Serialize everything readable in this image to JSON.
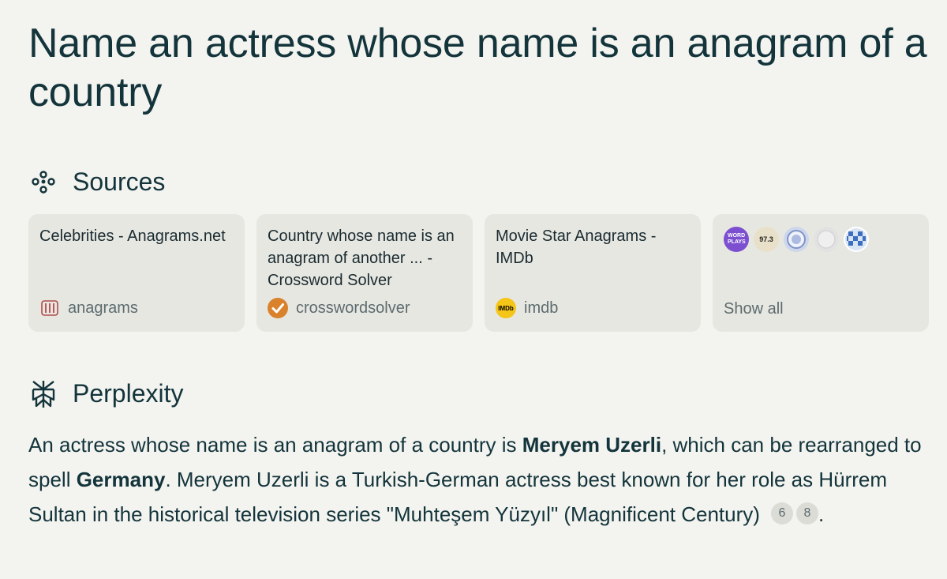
{
  "query": {
    "title": "Name an actress whose name is an anagram of a country"
  },
  "sources": {
    "heading": "Sources",
    "cards": [
      {
        "title": "Celebrities - Anagrams.net",
        "domain": "anagrams",
        "icon": "anagrams-favicon"
      },
      {
        "title": "Country whose name is an anagram of another ... - Crossword Solver",
        "domain": "crosswordsolver",
        "icon": "checkmark-favicon"
      },
      {
        "title": "Movie Star Anagrams - IMDb",
        "domain": "imdb",
        "icon": "imdb-favicon"
      }
    ],
    "more": {
      "label": "Show all",
      "favicons": [
        "wordplays-favicon",
        "radio-97-3-favicon",
        "globe-favicon",
        "blank-favicon",
        "checker-favicon"
      ],
      "wordplays_text": "WORD PLAYS",
      "radio_text": "97.3"
    },
    "imdb_badge": "IMDb"
  },
  "answer": {
    "heading": "Perplexity",
    "part1": "An actress whose name is an anagram of a country is ",
    "bold1": "Meryem Uzerli",
    "part2": ", which can be rearranged to spell ",
    "bold2": "Germany",
    "part3": ". Meryem Uzerli is a Turkish-German actress best known for her role as Hürrem Sultan in the historical television series \"Muhteşem Yüzyıl\" (Magnificent Century)",
    "citations": [
      "6",
      "8"
    ],
    "end": "."
  },
  "colors": {
    "background": "#f3f3ef",
    "card": "#e7e7e2",
    "text": "#13343b",
    "muted": "#5d6b6e",
    "checkmark_orange": "#d9822b",
    "imdb_yellow": "#f5c518"
  }
}
